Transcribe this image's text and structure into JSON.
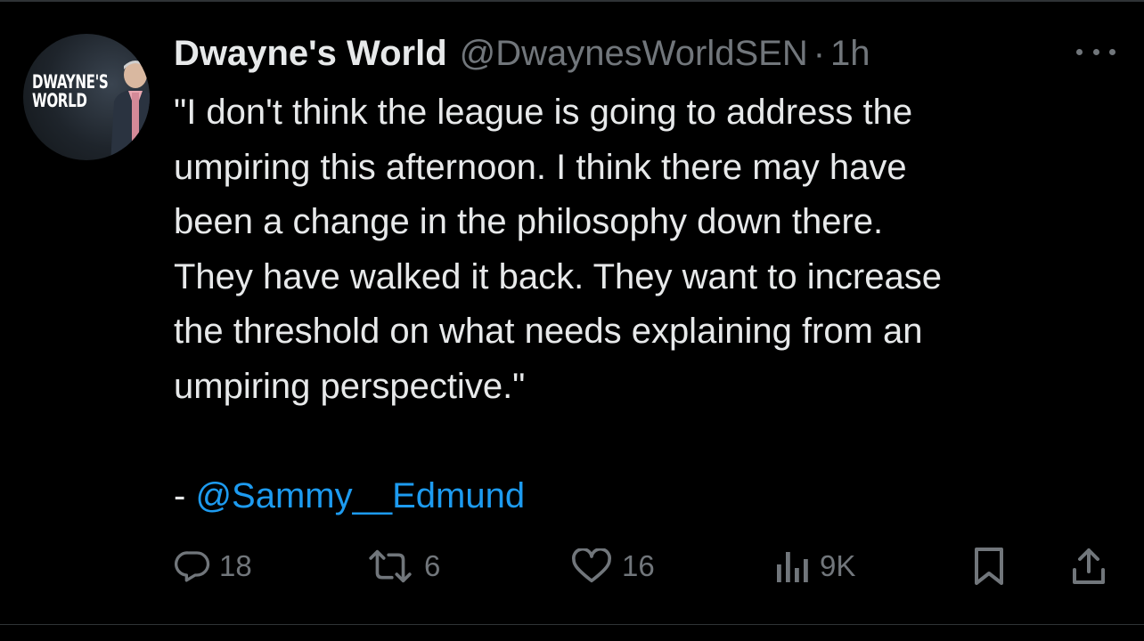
{
  "author": {
    "display_name": "Dwayne's World",
    "handle": "@DwaynesWorldSEN",
    "separator": "·",
    "time": "1h",
    "avatar_text": "DWAYNE'S\nWORLD"
  },
  "tweet": {
    "text": "\"I don't think the league is going to address the\numpiring this afternoon. I think there may have\nbeen a change in the philosophy down there.\nThey have walked it back. They want to increase\nthe threshold on what needs explaining from an\numpiring perspective.\"",
    "attribution_prefix": "- ",
    "attribution_mention": "@Sammy__Edmund"
  },
  "actions": {
    "replies": "18",
    "reposts": "6",
    "likes": "16",
    "views": "9K"
  },
  "colors": {
    "background": "#000000",
    "text": "#e7e9ea",
    "secondary": "#71767b",
    "accent": "#1d9bf0"
  },
  "icons": {
    "reply": "reply-icon",
    "repost": "repost-icon",
    "like": "heart-icon",
    "views": "views-icon",
    "bookmark": "bookmark-icon",
    "share": "share-icon",
    "more": "more-icon"
  }
}
